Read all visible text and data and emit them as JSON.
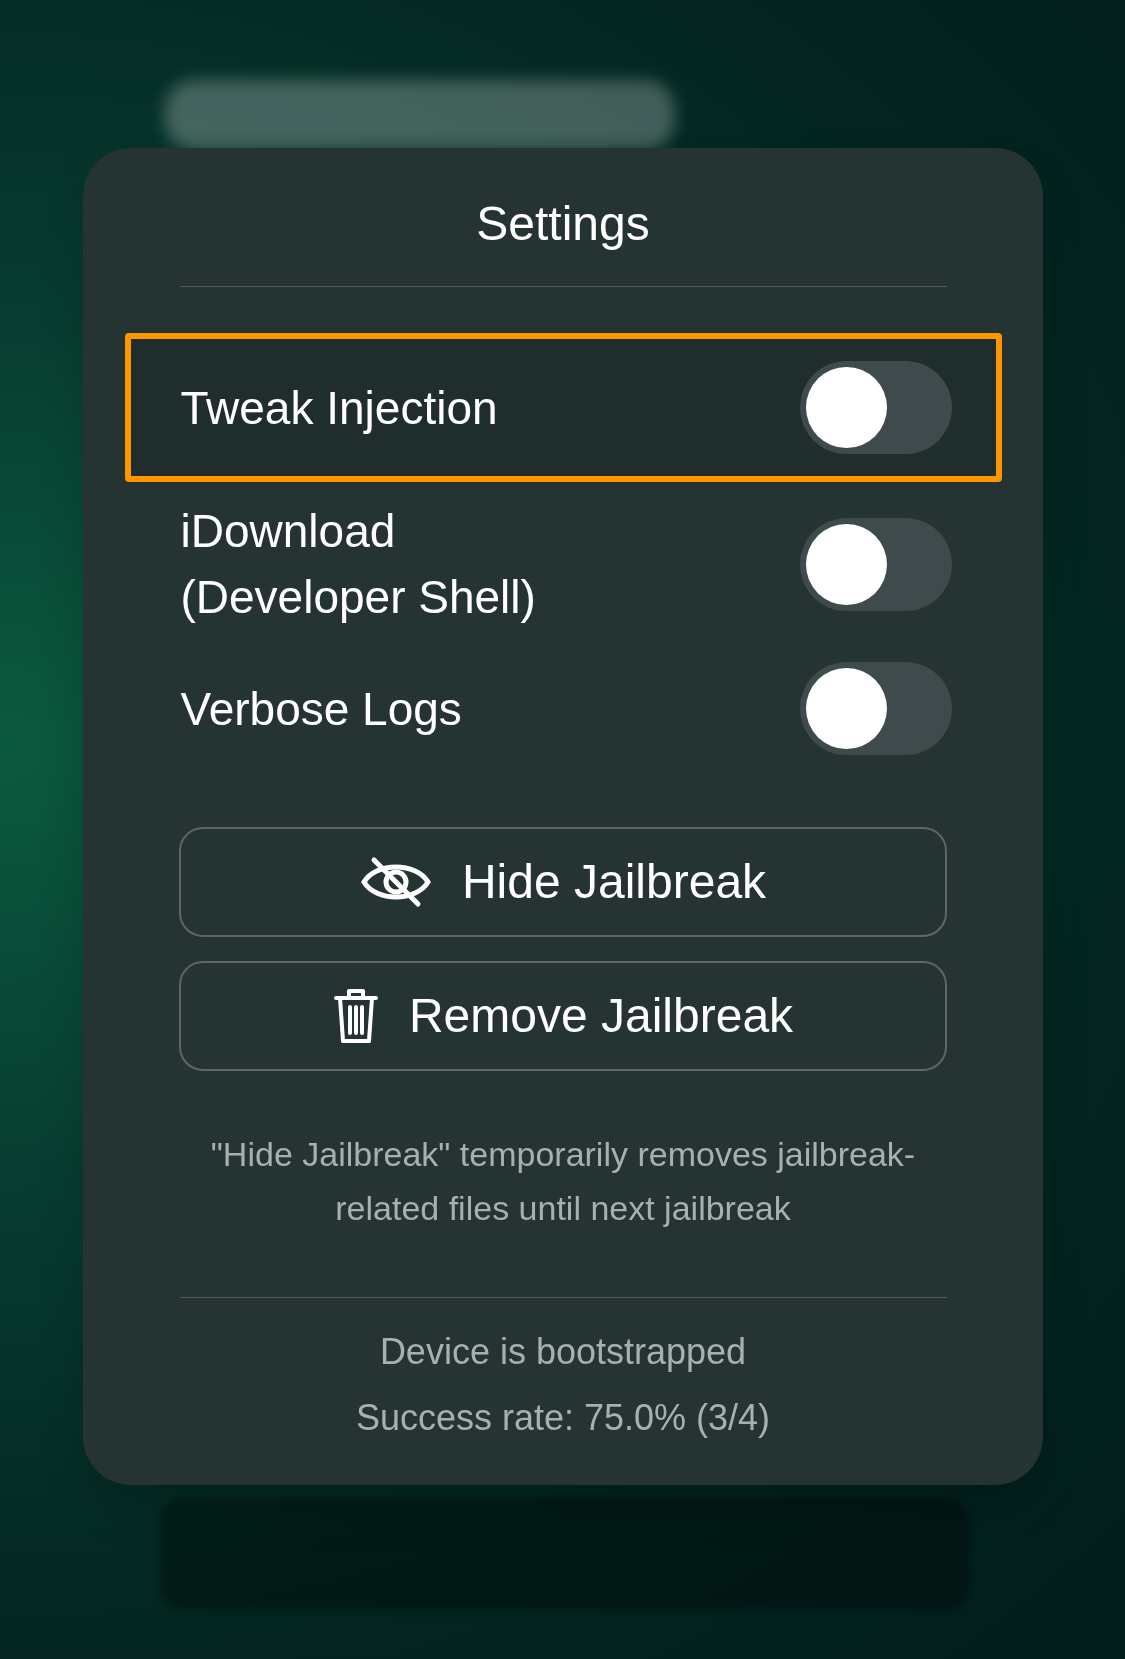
{
  "settings": {
    "title": "Settings",
    "options": [
      {
        "label": "Tweak Injection",
        "on": false,
        "highlighted": true
      },
      {
        "label": "iDownload\n(Developer Shell)",
        "on": false,
        "highlighted": false
      },
      {
        "label": "Verbose Logs",
        "on": false,
        "highlighted": false
      }
    ],
    "buttons": [
      {
        "kind": "hide",
        "label": "Hide Jailbreak"
      },
      {
        "kind": "remove",
        "label": "Remove Jailbreak"
      }
    ],
    "note": "\"Hide Jailbreak\" temporarily removes jailbreak-related files until next jailbreak",
    "status": [
      "Device is bootstrapped",
      "Success rate: 75.0% (3/4)"
    ]
  }
}
